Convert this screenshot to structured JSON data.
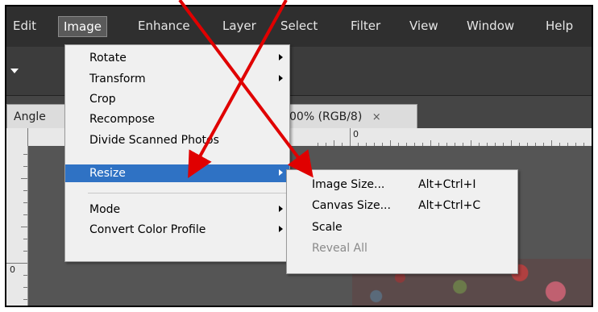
{
  "menubar": {
    "items": [
      {
        "label": "Edit"
      },
      {
        "label": "Image",
        "active": true
      },
      {
        "label": "Enhance"
      },
      {
        "label": "Layer"
      },
      {
        "label": "Select"
      },
      {
        "label": "Filter"
      },
      {
        "label": "View"
      },
      {
        "label": "Window"
      },
      {
        "label": "Help"
      }
    ]
  },
  "document": {
    "tab_left": "Angle",
    "tab_right": "00% (RGB/8)",
    "tab_close": "×",
    "ruler_zero_h": "0",
    "ruler_zero_v": "0"
  },
  "image_menu": {
    "items": [
      {
        "label": "Rotate",
        "submenu": true
      },
      {
        "label": "Transform",
        "submenu": true
      },
      {
        "label": "Crop"
      },
      {
        "label": "Recompose"
      },
      {
        "label": "Divide Scanned Photos"
      },
      {
        "label": "Resize",
        "submenu": true,
        "highlighted": true
      },
      {
        "label": "Mode",
        "submenu": true
      },
      {
        "label": "Convert Color Profile",
        "submenu": true
      }
    ]
  },
  "resize_submenu": {
    "items": [
      {
        "label": "Image Size...",
        "shortcut": "Alt+Ctrl+I"
      },
      {
        "label": "Canvas Size...",
        "shortcut": "Alt+Ctrl+C"
      },
      {
        "label": "Scale",
        "shortcut": ""
      },
      {
        "label": "Reveal All",
        "shortcut": "",
        "disabled": true
      }
    ]
  },
  "colors": {
    "menu_highlight": "#2f72c4",
    "annotation_arrow": "#e00000"
  }
}
